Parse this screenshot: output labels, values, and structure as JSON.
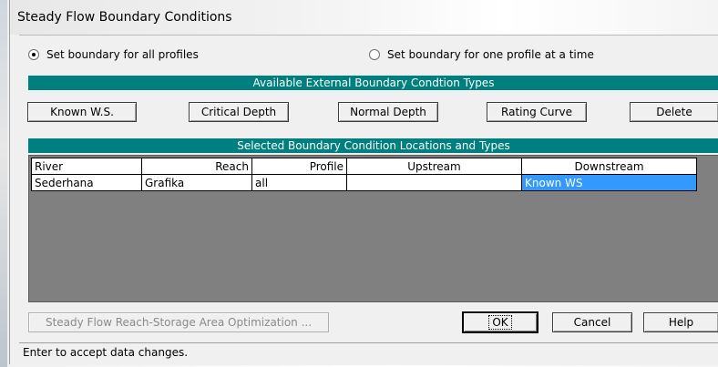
{
  "window": {
    "title": "Steady Flow Boundary Conditions"
  },
  "options": {
    "all_profiles": {
      "label": "Set boundary for all profiles",
      "checked": true
    },
    "one_profile": {
      "label": "Set boundary for one profile at a time",
      "checked": false
    }
  },
  "available_types": {
    "header": "Available External Boundary Condtion Types",
    "buttons": [
      "Known W.S.",
      "Critical Depth",
      "Normal Depth",
      "Rating Curve",
      "Delete"
    ]
  },
  "selected": {
    "header": "Selected Boundary Condition Locations and Types",
    "columns": [
      "River",
      "Reach",
      "Profile",
      "Upstream",
      "Downstream"
    ],
    "rows": [
      {
        "river": "Sederhana",
        "reach": "Grafika",
        "profile": "all",
        "upstream": "",
        "downstream": "Known WS"
      }
    ]
  },
  "footer": {
    "optimization_label": "Steady Flow Reach-Storage Area Optimization ...",
    "ok_label": "OK",
    "cancel_label": "Cancel",
    "help_label": "Help"
  },
  "status_text": "Enter to accept data changes.",
  "colors": {
    "band": "#007f7f",
    "selection": "#3399ff",
    "grid_bg": "#808080"
  }
}
